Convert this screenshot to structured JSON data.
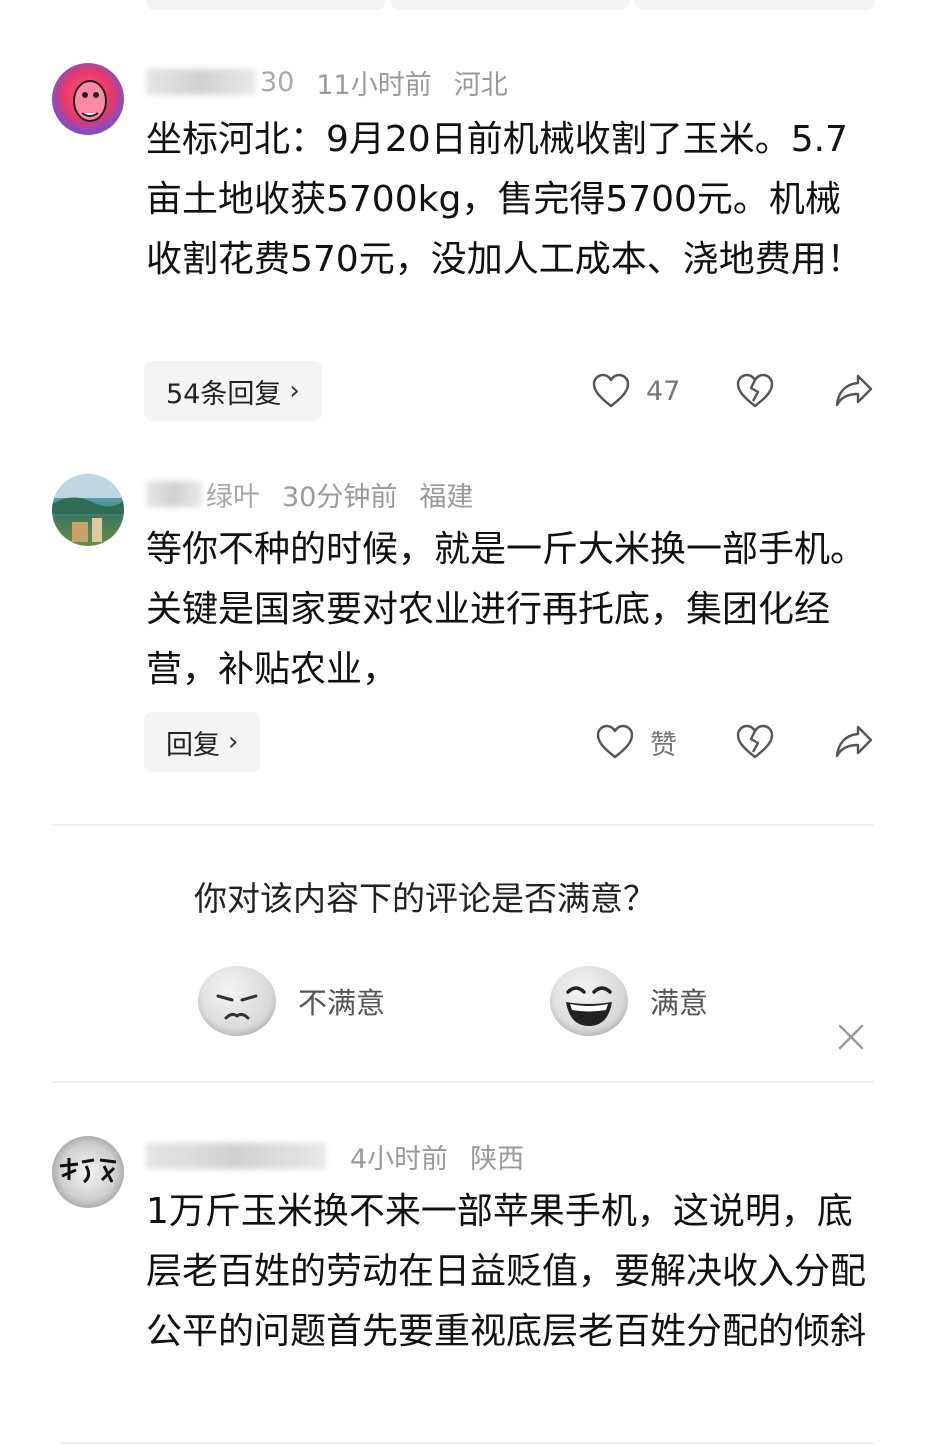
{
  "comments": [
    {
      "name": "30",
      "time": "11小时前",
      "location": "河北",
      "text": "坐标河北：9月20日前机械收割了玉米。5.7亩土地收获5700kg，售完得5700元。机械收割花费570元，没加人工成本、浇地费用！",
      "reply_label": "54条回复",
      "like_count": "47"
    },
    {
      "name": "绿叶",
      "time": "30分钟前",
      "location": "福建",
      "text": "等你不种的时候，就是一斤大米换一部手机。关键是国家要对农业进行再托底，集团化经营，补贴农业，",
      "reply_label": "回复",
      "like_count": "赞"
    },
    {
      "name": "",
      "time": "4小时前",
      "location": "陕西",
      "text": "1万斤玉米换不来一部苹果手机，这说明，底层老百姓的劳动在日益贬值，要解决收入分配公平的问题首先要重视底层老百姓分配的倾斜"
    }
  ],
  "survey": {
    "question": "你对该内容下的评论是否满意？",
    "dissatisfied_label": "不满意",
    "satisfied_label": "满意"
  },
  "icons": {
    "like": "heart-icon",
    "dislike": "broken-heart-icon",
    "share": "share-arrow-icon",
    "chevron": "chevron-right-icon",
    "close": "close-icon"
  }
}
